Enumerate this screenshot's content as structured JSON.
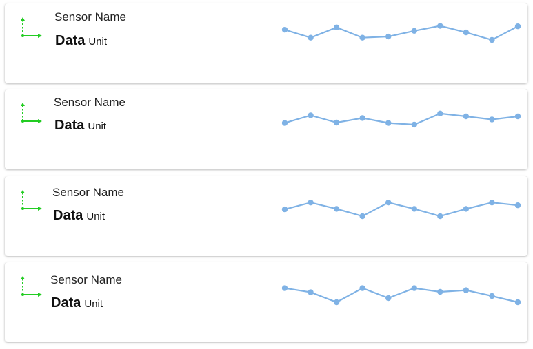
{
  "colors": {
    "icon": "#22cc22",
    "spark": "#7fb2e5",
    "card_background": "#ffffff"
  },
  "sensors": [
    {
      "name": "Sensor Name",
      "value": "Data",
      "unit": "Unit",
      "icon": "axis-arrows-icon",
      "trend": [
        0.45,
        0.1,
        0.55,
        0.1,
        0.15,
        0.4,
        0.62,
        0.33,
        0.0,
        0.6
      ]
    },
    {
      "name": "Sensor Name",
      "value": "Data",
      "unit": "Unit",
      "icon": "axis-arrows-icon",
      "trend": [
        0.18,
        0.55,
        0.2,
        0.42,
        0.18,
        0.1,
        0.64,
        0.5,
        0.35,
        0.5
      ]
    },
    {
      "name": "Sensor Name",
      "value": "Data",
      "unit": "Unit",
      "icon": "axis-arrows-icon",
      "trend": [
        0.3,
        0.6,
        0.32,
        0.0,
        0.6,
        0.32,
        0.0,
        0.32,
        0.6,
        0.48
      ]
    },
    {
      "name": "Sensor Name",
      "value": "Data",
      "unit": "Unit",
      "icon": "axis-arrows-icon",
      "trend": [
        0.68,
        0.48,
        0.0,
        0.68,
        0.2,
        0.68,
        0.5,
        0.58,
        0.3,
        0.0
      ]
    }
  ]
}
